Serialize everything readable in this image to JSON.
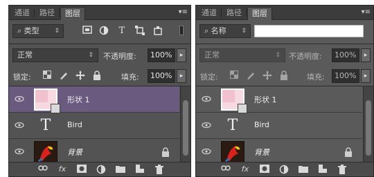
{
  "left_panel": {
    "tabs": [
      {
        "label": "通道"
      },
      {
        "label": "路径"
      },
      {
        "label": "图层"
      }
    ],
    "filter": {
      "label": "类型"
    },
    "filter_icons": [
      "image-filter-icon",
      "adjustment-filter-icon",
      "type-filter-icon",
      "shape-filter-icon",
      "smart-object-filter-icon"
    ],
    "blend_mode": "正常",
    "opacity_label": "不透明度:",
    "opacity_value": "100%",
    "lock_label": "锁定:",
    "fill_label": "填充:",
    "fill_value": "100%",
    "layers": [
      {
        "name": "形状 1",
        "thumb": "shape",
        "selected": true
      },
      {
        "name": "Bird",
        "thumb": "type",
        "selected": false
      },
      {
        "name": "背景",
        "thumb": "image",
        "selected": false,
        "locked": true
      }
    ],
    "footer_icons": [
      "link-layers-icon",
      "fx-icon",
      "add-mask-icon",
      "adjustment-layer-icon",
      "group-folder-icon",
      "new-layer-icon",
      "delete-icon"
    ]
  },
  "right_panel": {
    "tabs": [
      {
        "label": "通道"
      },
      {
        "label": "路径"
      },
      {
        "label": "图层"
      }
    ],
    "filter": {
      "label": "名称"
    },
    "search_value": "",
    "blend_mode": "正常",
    "opacity_label": "不透明度:",
    "opacity_value": "100%",
    "lock_label": "锁定:",
    "fill_label": "填充:",
    "fill_value": "100%",
    "layers": [
      {
        "name": "形状 1",
        "thumb": "shape",
        "selected": false
      },
      {
        "name": "Bird",
        "thumb": "type",
        "selected": false
      },
      {
        "name": "背景",
        "thumb": "image",
        "selected": false,
        "locked": true
      }
    ]
  },
  "glyphs": {
    "menu": "▾≡",
    "arrow": "▾",
    "search": "⌕",
    "T": "T",
    "fx": "fx"
  }
}
